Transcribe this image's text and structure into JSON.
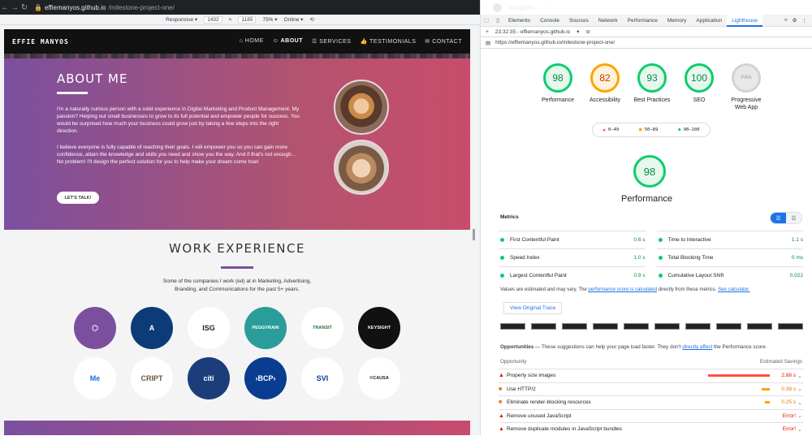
{
  "browser": {
    "url_host": "effiemanyos.github.io",
    "url_path": "/milestone-project-one/",
    "profile": "Incognito"
  },
  "devbar": {
    "device": "Responsive ▾",
    "width": "1432",
    "x": "×",
    "height": "1185",
    "zoom": "75% ▾",
    "network": "Online ▾"
  },
  "site": {
    "logo": "EFFIE MANYOS",
    "nav": [
      "HOME",
      "ABOUT",
      "SERVICES",
      "TESTIMONIALS",
      "CONTACT"
    ],
    "hero_title": "ABOUT ME",
    "para1": "I'm a naturally curious person with a solid experience in Digital Marketing and Product Management. My passion? Helping out small businesses to grow to its full potential and empower people for success. You would be surprised how much your business could grow just by taking a few steps into the right direction.",
    "para2": "I believe everyone is fully capable of reaching their goals. I will empower you so you can gain more confidence, attain the knowledge and skills you need and show you the way. And if that's not enough... No problem! I'll design the perfect solution for you to help make your dream come true!",
    "cta": "LET'S TALK!",
    "work_title": "WORK EXPERIENCE",
    "work_text": "Some of the companies I work (ed) at in Marketing, Advertising, Branding, and Communications for the past 5+ years.",
    "logos": [
      {
        "text": "⬡",
        "bg": "#7b4f9e",
        "color": "#ffffff"
      },
      {
        "text": "A",
        "bg": "#0c3c78",
        "color": "#ffffff"
      },
      {
        "text": "ISG",
        "bg": "#ffffff",
        "color": "#222222"
      },
      {
        "text": "PEGGYRAIN",
        "bg": "#2a9d9a",
        "color": "#ffffff"
      },
      {
        "text": "TRANSIT",
        "bg": "#ffffff",
        "color": "#2c6b3a"
      },
      {
        "text": "KEYSIGHT",
        "bg": "#111111",
        "color": "#ffffff"
      },
      {
        "text": "Me",
        "bg": "#ffffff",
        "color": "#1e6fd8"
      },
      {
        "text": "CRIPT",
        "bg": "#ffffff",
        "color": "#6a5440"
      },
      {
        "text": "citi",
        "bg": "#1b3e7a",
        "color": "#ffffff"
      },
      {
        "text": "›BCP›",
        "bg": "#0a3d8f",
        "color": "#ffffff"
      },
      {
        "text": "SVI",
        "bg": "#ffffff",
        "color": "#0a3d8f"
      },
      {
        "text": "©CAUSA",
        "bg": "#ffffff",
        "color": "#222222"
      }
    ]
  },
  "devtools": {
    "tabs": [
      "Elements",
      "Console",
      "Sources",
      "Network",
      "Performance",
      "Memory",
      "Application",
      "Lighthouse"
    ],
    "active_tab": "Lighthouse",
    "report_label": "23:32:35 - effiemanyos.github.io",
    "report_url": "https://effiemanyos.github.io/milestone-project-one/",
    "scores": [
      {
        "label": "Performance",
        "value": "98",
        "color": "#0cce6b",
        "bg": "#e6f7ee",
        "text": "#0a8a46"
      },
      {
        "label": "Accessibility",
        "value": "82",
        "color": "#ffa400",
        "bg": "#fff3dd",
        "text": "#c33300"
      },
      {
        "label": "Best Practices",
        "value": "93",
        "color": "#0cce6b",
        "bg": "#e6f7ee",
        "text": "#0a8a46"
      },
      {
        "label": "SEO",
        "value": "100",
        "color": "#0cce6b",
        "bg": "#e6f7ee",
        "text": "#0a8a46"
      },
      {
        "label": "Progressive Web App",
        "value": "PWA",
        "color": "#d3d3d3",
        "bg": "#e8e8e8",
        "text": "#9e9e9e"
      }
    ],
    "legend": [
      "0–49",
      "50–89",
      "90–100"
    ],
    "perf_score": "98",
    "perf_title": "Performance",
    "metrics_title": "Metrics",
    "metrics": [
      {
        "name": "First Contentful Paint",
        "value": "0.6 s"
      },
      {
        "name": "Time to Interactive",
        "value": "1.1 s"
      },
      {
        "name": "Speed Index",
        "value": "1.0 s"
      },
      {
        "name": "Total Blocking Time",
        "value": "0 ms"
      },
      {
        "name": "Largest Contentful Paint",
        "value": "0.9 s"
      },
      {
        "name": "Cumulative Layout Shift",
        "value": "0.022"
      }
    ],
    "note_a": "Values are estimated and may vary. The ",
    "note_link": "performance score is calculated",
    "note_b": " directly from these metrics. ",
    "note_link2": "See calculator.",
    "trace_button": "View Original Trace",
    "opp_a": "Opportunities",
    "opp_b": " — These suggestions can help your page load faster. They don't ",
    "opp_link": "directly affect",
    "opp_c": " the Performance score.",
    "opp_col1": "Opportunity",
    "opp_col2": "Estimated Savings",
    "opportunities": [
      {
        "name": "Properly size images",
        "saving": "2.88 s",
        "level": "red",
        "bar": 0.95
      },
      {
        "name": "Use HTTP/2",
        "saving": "0.39 s",
        "level": "orange",
        "bar": 0.13
      },
      {
        "name": "Eliminate render-blocking resources",
        "saving": "0.25 s",
        "level": "orange",
        "bar": 0.08
      },
      {
        "name": "Remove unused JavaScript",
        "saving": "Error!",
        "level": "red",
        "bar": 0
      },
      {
        "name": "Remove duplicate modules in JavaScript bundles",
        "saving": "Error!",
        "level": "red",
        "bar": 0
      }
    ]
  }
}
